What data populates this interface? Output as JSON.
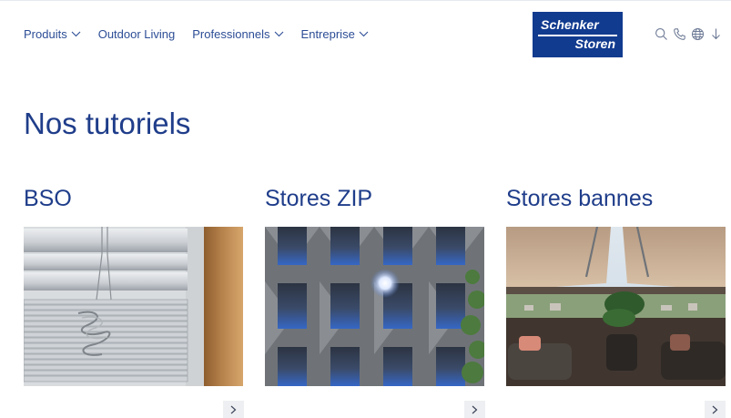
{
  "nav": {
    "items": [
      {
        "label": "Produits",
        "dropdown": true
      },
      {
        "label": "Outdoor Living",
        "dropdown": false
      },
      {
        "label": "Professionnels",
        "dropdown": true
      },
      {
        "label": "Entreprise",
        "dropdown": true
      }
    ]
  },
  "logo": {
    "line1": "Schenker",
    "line2": "Storen"
  },
  "header_icons": [
    "search-icon",
    "phone-icon",
    "globe-icon",
    "download-icon"
  ],
  "page": {
    "title": "Nos tutoriels"
  },
  "cards": [
    {
      "title": "BSO",
      "image": "venetian-blind-photo"
    },
    {
      "title": "Stores ZIP",
      "image": "building-facade-photo"
    },
    {
      "title": "Stores bannes",
      "image": "terrace-awning-photo"
    }
  ],
  "colors": {
    "brand": "#113b8f",
    "text": "#1f3d8a",
    "button_bg": "#eeeff2"
  }
}
